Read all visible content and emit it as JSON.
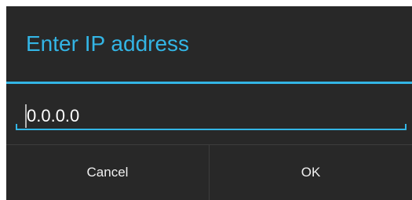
{
  "dialog": {
    "title": "Enter IP address",
    "accent_color": "#33b5e5",
    "background_color": "#282828",
    "ip_field": {
      "value": "0.0.0.0"
    },
    "buttons": {
      "cancel_label": "Cancel",
      "ok_label": "OK"
    }
  }
}
